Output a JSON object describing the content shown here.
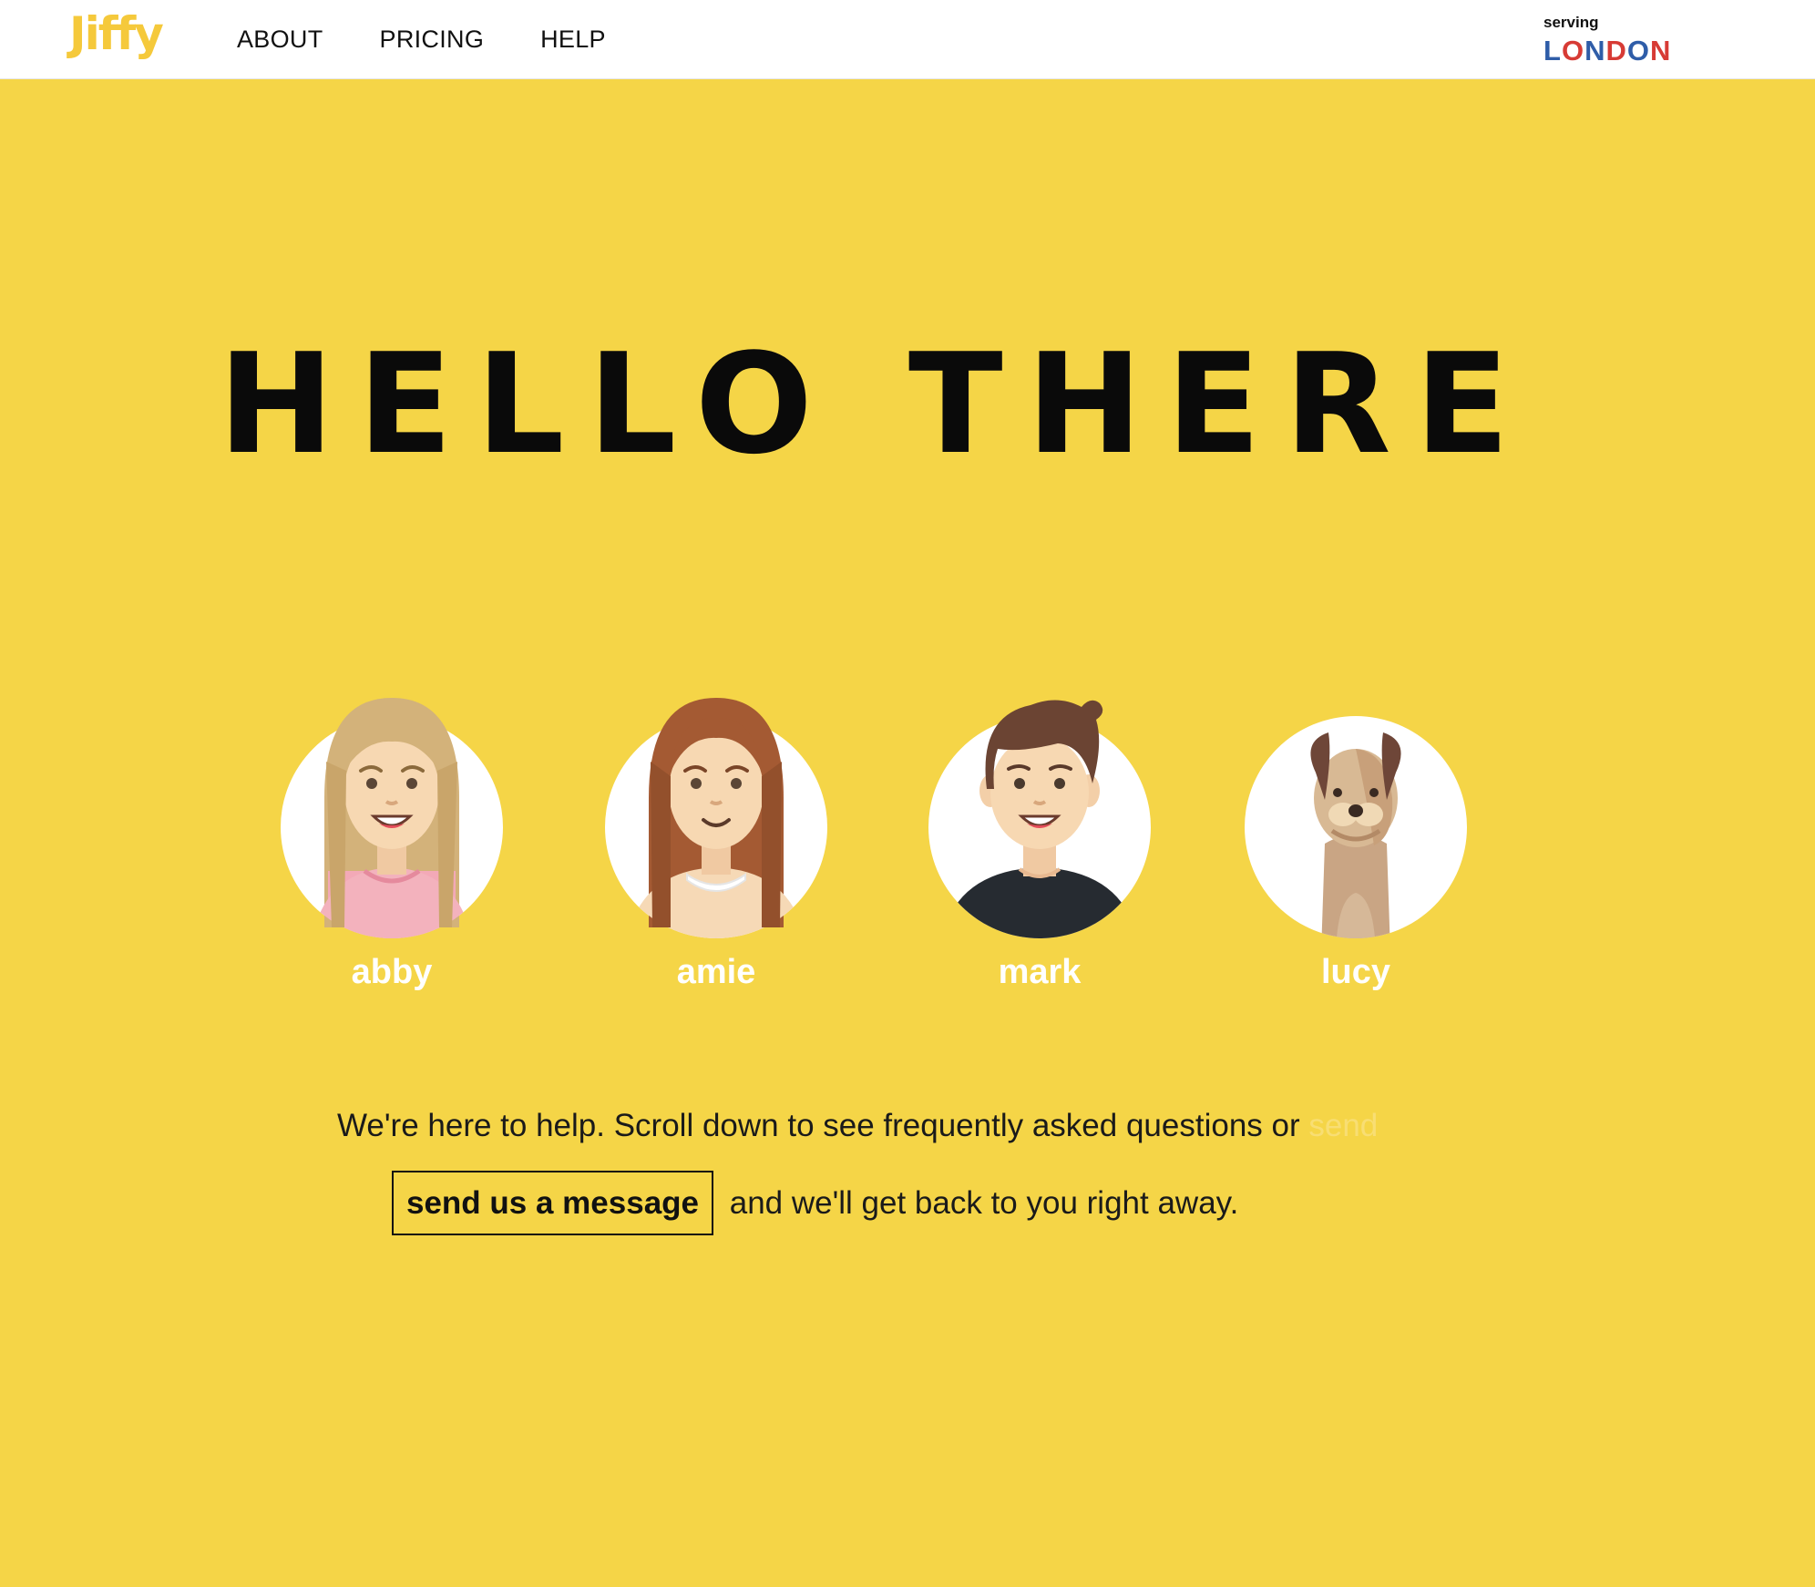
{
  "header": {
    "logo": "Jiffy",
    "nav": [
      "ABOUT",
      "PRICING",
      "HELP"
    ],
    "serving_label": "serving",
    "city_letters": [
      "L",
      "O",
      "N",
      "D",
      "O",
      "N"
    ],
    "city_colors": [
      "#2F5DA8",
      "#D73B35",
      "#2F5DA8",
      "#D73B35",
      "#2F5DA8",
      "#D73B35"
    ]
  },
  "hero": {
    "title": "HELLO THERE"
  },
  "team": [
    {
      "name": "abby",
      "avatar": "abby-avatar"
    },
    {
      "name": "amie",
      "avatar": "amie-avatar"
    },
    {
      "name": "mark",
      "avatar": "mark-avatar"
    },
    {
      "name": "lucy",
      "avatar": "lucy-dog-avatar"
    }
  ],
  "message": {
    "line1": "We're here to help. Scroll down to see frequently asked questions or",
    "ghost": "send",
    "button_label": "send us a message",
    "line2_after": "and we'll get back to you right away."
  },
  "colors": {
    "background": "#F5D547",
    "logo": "#F5C93B",
    "header_bg": "#ffffff",
    "name_text": "#ffffff"
  }
}
